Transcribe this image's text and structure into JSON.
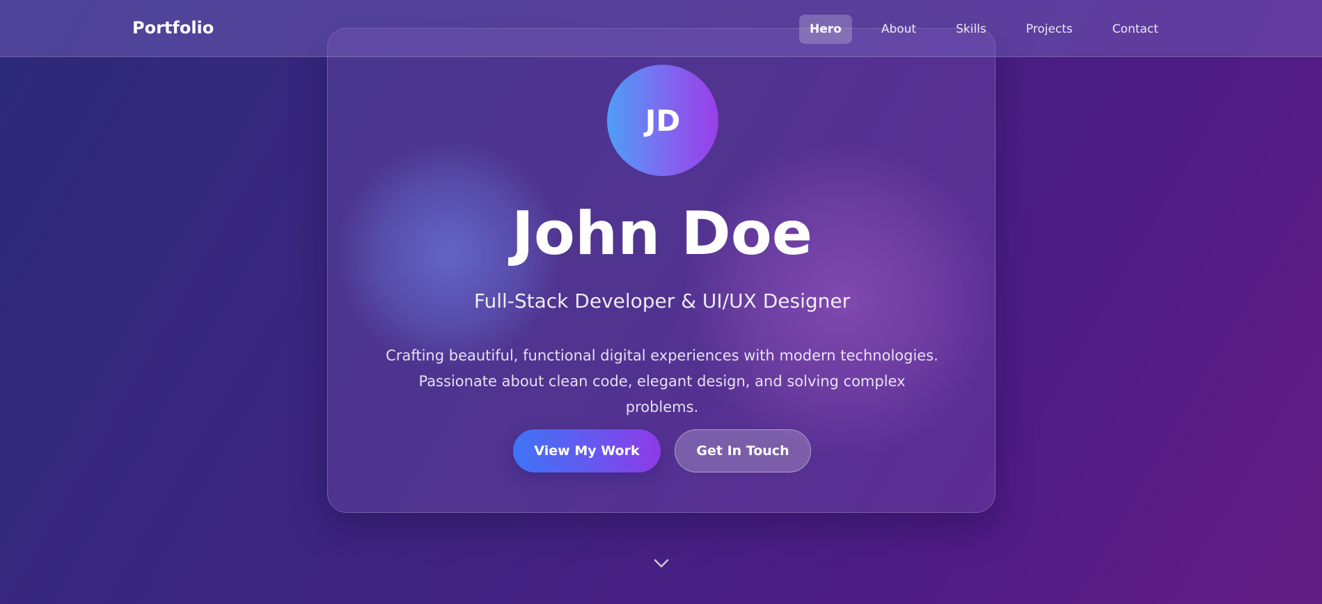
{
  "navbar": {
    "brand": "Portfolio",
    "links": [
      {
        "label": "Hero",
        "active": true
      },
      {
        "label": "About",
        "active": false
      },
      {
        "label": "Skills",
        "active": false
      },
      {
        "label": "Projects",
        "active": false
      },
      {
        "label": "Contact",
        "active": false
      }
    ]
  },
  "hero": {
    "avatar_initials": "JD",
    "name": "John Doe",
    "subtitle": "Full-Stack Developer & UI/UX Designer",
    "description_lines": [
      "Crafting beautiful, functional digital experiences with modern technologies.",
      "Passionate about clean code, elegant design, and solving complex problems."
    ],
    "primary_button": "View My Work",
    "secondary_button": "Get In Touch"
  },
  "icons": {
    "scroll_indicator": "chevron-down-icon"
  },
  "colors": {
    "background_start": "#2d2a7a",
    "background_end": "#631d84",
    "avatar_gradient_start": "#4f9ef7",
    "avatar_gradient_end": "#9a3ee8",
    "primary_button_start": "#3f74f6",
    "primary_button_end": "#8e3ae6"
  }
}
